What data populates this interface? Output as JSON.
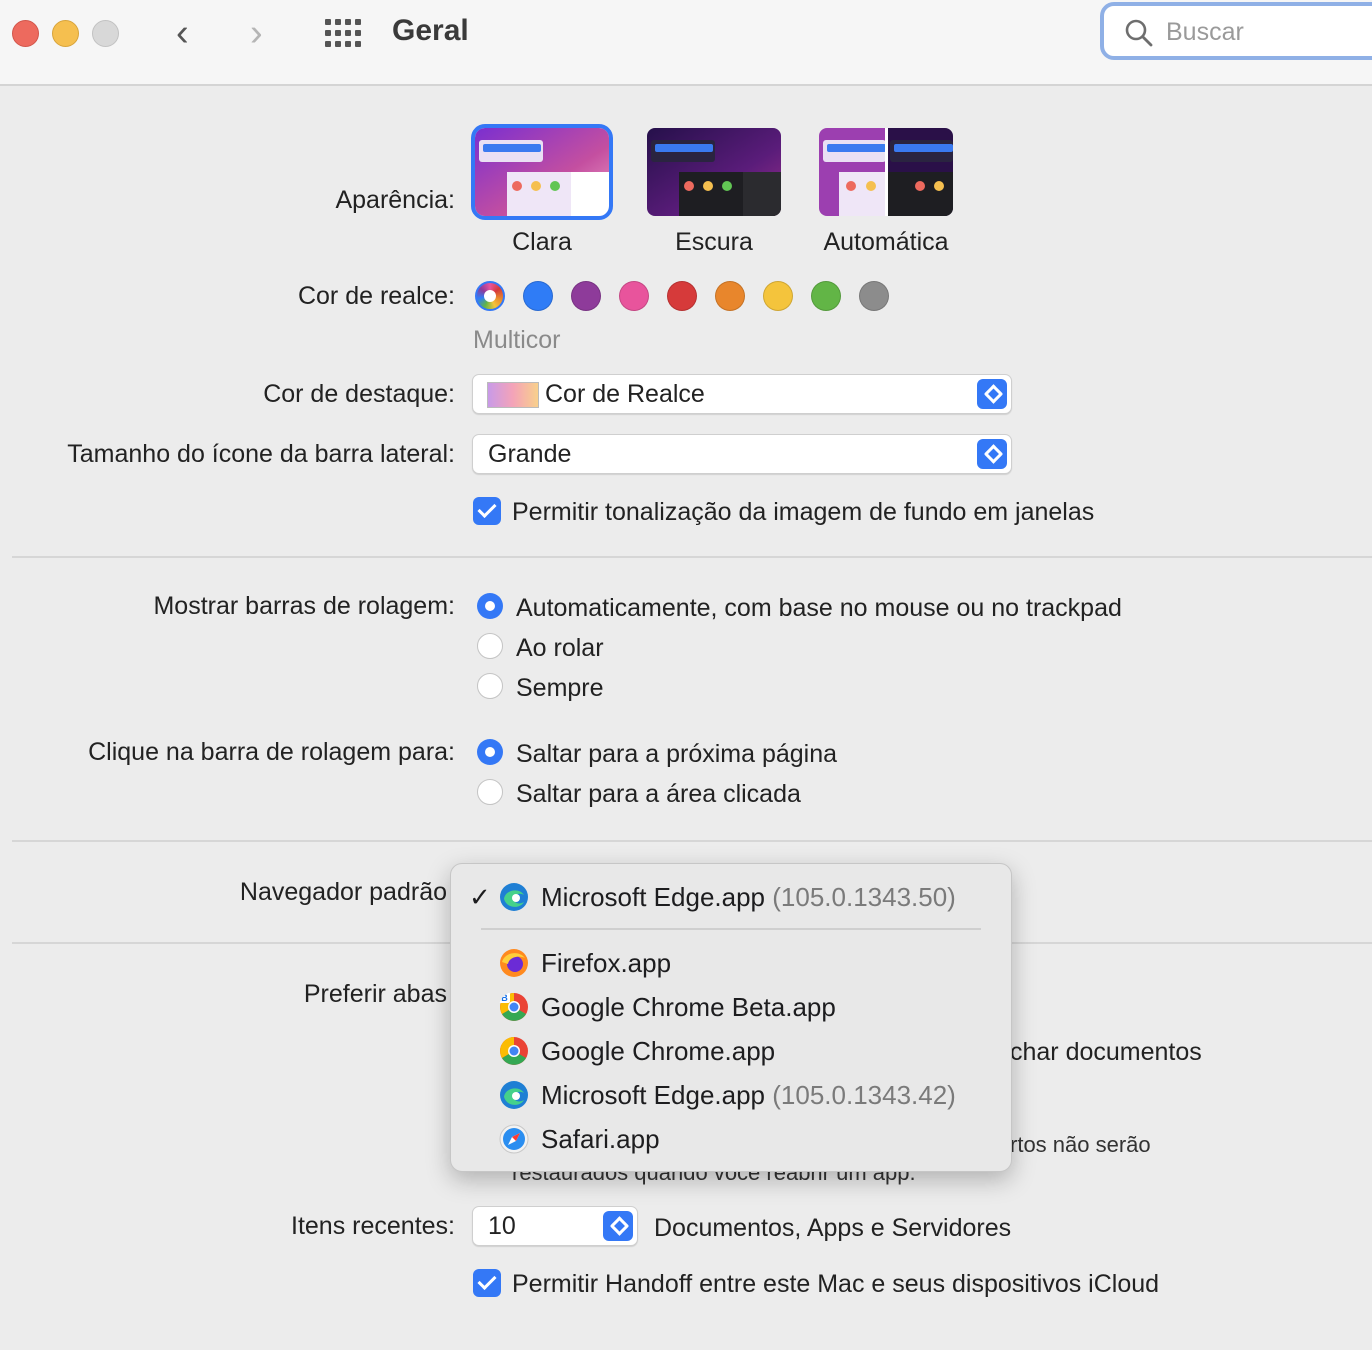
{
  "window": {
    "title": "Geral",
    "search_placeholder": "Buscar"
  },
  "appearance": {
    "label": "Aparência:",
    "options": [
      "Clara",
      "Escura",
      "Automática"
    ],
    "selected": "Clara"
  },
  "accent": {
    "label": "Cor de realce:",
    "colors": [
      "multicolor",
      "#2f7cf6",
      "#8e3b9a",
      "#e8549c",
      "#d63a3a",
      "#e8862c",
      "#f4c43c",
      "#62b546",
      "#8c8c8c"
    ],
    "selected_name": "Multicor"
  },
  "highlight": {
    "label": "Cor de destaque:",
    "value": "Cor de Realce"
  },
  "sidebar_icon": {
    "label": "Tamanho do ícone da barra lateral:",
    "value": "Grande"
  },
  "tinting": {
    "label": "Permitir tonalização da imagem de fundo em janelas",
    "checked": true
  },
  "scrollbars": {
    "label": "Mostrar barras de rolagem:",
    "options": [
      "Automaticamente, com base no mouse ou no trackpad",
      "Ao rolar",
      "Sempre"
    ],
    "selected_index": 0
  },
  "scroll_click": {
    "label": "Clique na barra de rolagem para:",
    "options": [
      "Saltar para a próxima página",
      "Saltar para a área clicada"
    ],
    "selected_index": 0
  },
  "default_browser": {
    "label": "Navegador padrão",
    "menu": {
      "selected": {
        "name": "Microsoft Edge.app",
        "version": "(105.0.1343.50)"
      },
      "items": [
        {
          "name": "Firefox.app",
          "version": "",
          "icon": "firefox-icon"
        },
        {
          "name": "Google Chrome Beta.app",
          "version": "",
          "icon": "chrome-beta-icon"
        },
        {
          "name": "Google Chrome.app",
          "version": "",
          "icon": "chrome-icon"
        },
        {
          "name": "Microsoft Edge.app",
          "version": "(105.0.1343.42)",
          "icon": "edge-icon"
        },
        {
          "name": "Safari.app",
          "version": "",
          "icon": "safari-icon"
        }
      ]
    }
  },
  "prefer_tabs": {
    "label": "Preferir abas",
    "partial_text_1": "char documentos",
    "partial_text_2": "rtos não serão",
    "partial_text_3": "restaurados quando você reabrir um app."
  },
  "recent_items": {
    "label": "Itens recentes:",
    "value": "10",
    "suffix": "Documentos, Apps e Servidores"
  },
  "handoff": {
    "label": "Permitir Handoff entre este Mac e seus dispositivos iCloud",
    "checked": true
  }
}
